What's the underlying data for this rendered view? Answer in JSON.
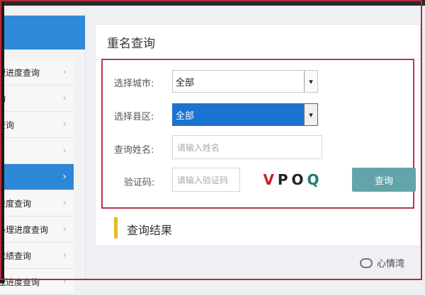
{
  "sidebar": {
    "items": [
      {
        "label": "理进度查询",
        "active": false
      },
      {
        "label": "询",
        "active": false
      },
      {
        "label": "查询",
        "active": false
      },
      {
        "label": "",
        "active": false
      },
      {
        "label": "",
        "active": true
      },
      {
        "label": "进度查询",
        "active": false
      },
      {
        "label": "办理进度查询",
        "active": false
      },
      {
        "label": "成绩查询",
        "active": false
      },
      {
        "label": "理进度查询",
        "active": false
      }
    ]
  },
  "panel": {
    "title": "重名查询"
  },
  "form": {
    "city_label": "选择城市:",
    "city_value": "全部",
    "county_label": "选择县区:",
    "county_value": "全部",
    "name_label": "查询姓名:",
    "name_placeholder": "请输入姓名",
    "captcha_label": "验证码:",
    "captcha_placeholder": "请输入验证码",
    "captcha_chars": [
      "V",
      "P",
      "O",
      "Q"
    ],
    "submit_label": "查询"
  },
  "results": {
    "title": "查询结果"
  },
  "watermark": {
    "text": "心情湾"
  },
  "colors": {
    "sidebar_active": "#2d86d6",
    "select_active": "#1a73cf",
    "button": "#63a4aa",
    "highlight_border": "#b83848",
    "result_accent": "#e8b82a"
  }
}
